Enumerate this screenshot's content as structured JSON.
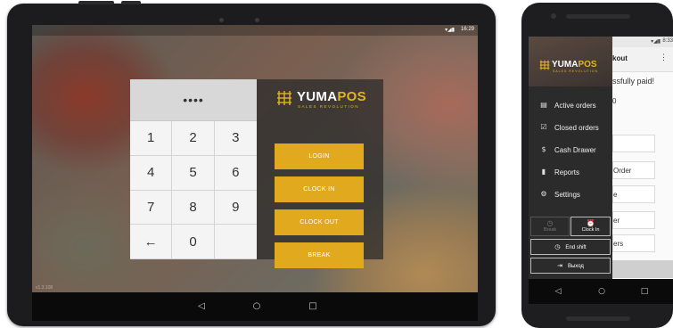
{
  "tablet": {
    "status_icons": "▾◢▮",
    "time": "16:29",
    "version": "v1.3.108",
    "pin_display": "••••",
    "keys": [
      "1",
      "2",
      "3",
      "4",
      "5",
      "6",
      "7",
      "8",
      "9",
      "←",
      "0",
      ""
    ],
    "logo": {
      "brand_main": "YUMA",
      "brand_accent": "POS",
      "tagline": "SALES REVOLUTION"
    },
    "buttons": {
      "login": "LOGIN",
      "clock_in": "CLOCK IN",
      "clock_out": "CLOCK OUT",
      "break": "BREAK"
    },
    "nav": {
      "back": "◁",
      "home": "○",
      "recents": "□"
    }
  },
  "phone": {
    "status_icons": "▾◢▮",
    "time": "8:33",
    "app_bar_title": "kout",
    "more_icon": "⋮",
    "background_text": {
      "paid": "ssfully paid!",
      "amount": "0",
      "order": "Order",
      "e": "e",
      "er": "er",
      "ers": "ers"
    },
    "logo": {
      "brand_main": "YUMA",
      "brand_accent": "POS",
      "tagline": "SALES REVOLUTION"
    },
    "menu": [
      {
        "icon": "receipt-icon",
        "glyph": "▤",
        "label": "Active orders"
      },
      {
        "icon": "check-receipt-icon",
        "glyph": "☑",
        "label": "Closed orders"
      },
      {
        "icon": "dollar-coin-icon",
        "glyph": "$",
        "label": "Cash Drawer"
      },
      {
        "icon": "bar-chart-icon",
        "glyph": "▮",
        "label": "Reports"
      },
      {
        "icon": "gear-icon",
        "glyph": "⚙",
        "label": "Settings"
      }
    ],
    "shift": {
      "break_label": "Break",
      "clock_in_label": "Clock In",
      "end_shift_label": "End shift",
      "logout_label": "Выход"
    },
    "nav": {
      "back": "◁",
      "home": "○",
      "recents": "□"
    },
    "colors": {
      "accent": "#e0a91e",
      "drawer": "#2b2b2b"
    }
  }
}
